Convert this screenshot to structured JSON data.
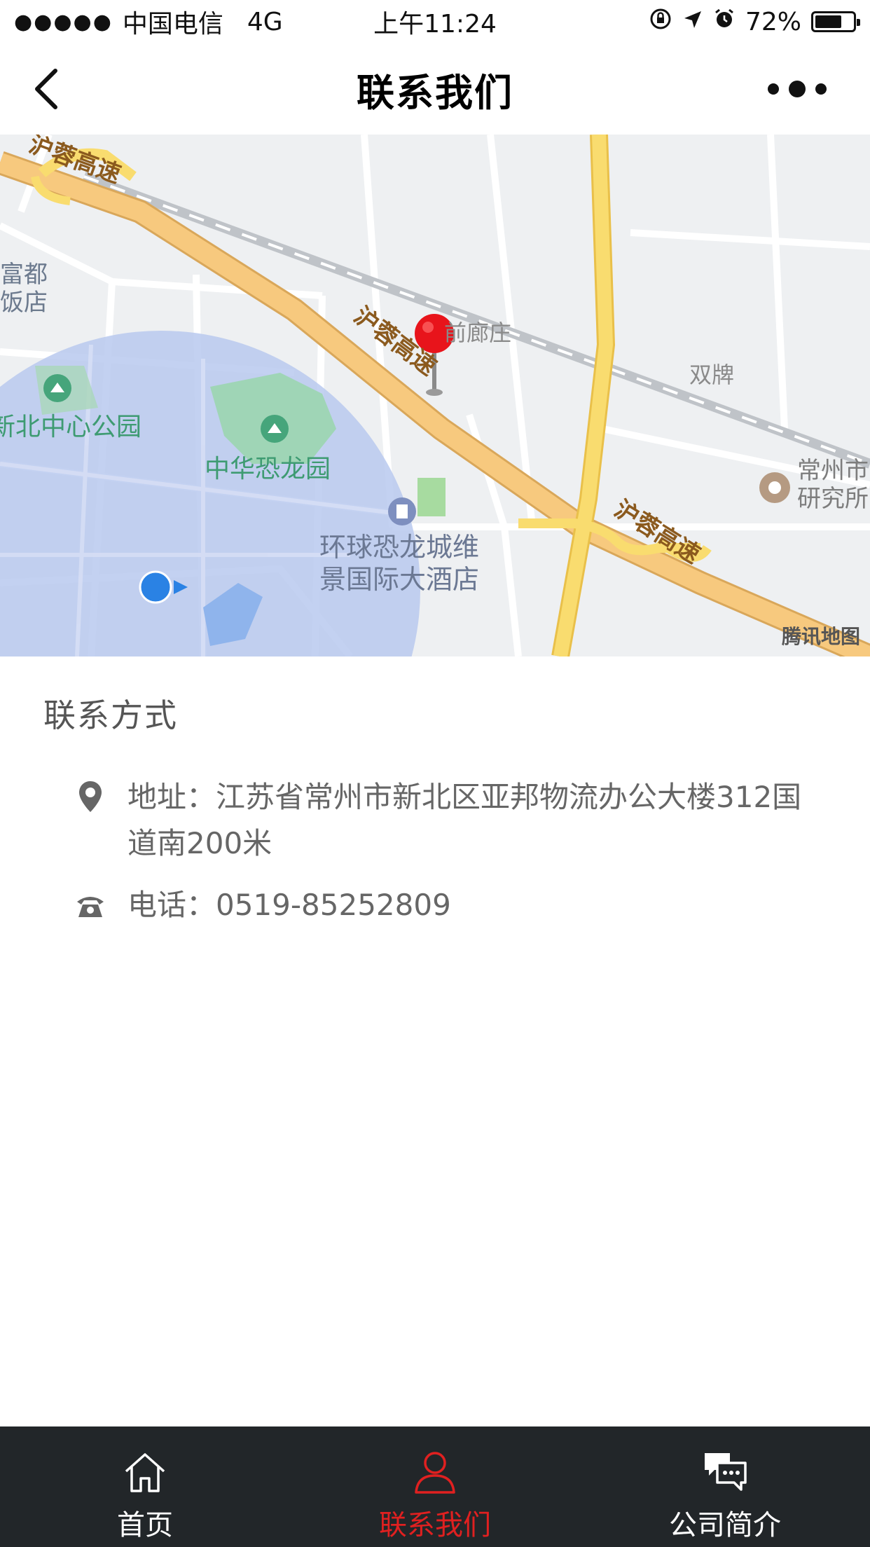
{
  "status_bar": {
    "signal": "●●●●●",
    "carrier": "中国电信",
    "network": "4G",
    "time": "上午11:24",
    "battery_percent": "72%",
    "battery_level": 0.72
  },
  "nav": {
    "title": "联系我们"
  },
  "map": {
    "labels": {
      "expressway_1": "沪蓉高速",
      "expressway_2": "沪蓉高速",
      "expressway_3": "沪蓉高速",
      "hotel_partial": "富都\n饭店",
      "park_left": "新北中心公园",
      "dino_park": "中华恐龙园",
      "village": "前廊庄",
      "shuangpai": "双牌",
      "institute": "常州市\n研究所",
      "hotel": "环球恐龙城维景国际大酒店"
    },
    "logo": "腾讯地图",
    "colors": {
      "background": "#eef0f2",
      "expressway": "#f7c97e",
      "major_road": "#f9dc6f",
      "radius_circle": "#b9c9ef",
      "park_green": "#9fd5b6",
      "water": "#8fb4ec",
      "pin": "#e8141b",
      "location_dot": "#2a82e4"
    }
  },
  "contact": {
    "section_title": "联系方式",
    "address": "地址：江苏省常州市新北区亚邦物流办公大楼312国道南200米",
    "phone": "电话：0519-85252809"
  },
  "tabbar": {
    "tabs": [
      {
        "label": "首页",
        "icon": "home-icon",
        "active": false
      },
      {
        "label": "联系我们",
        "icon": "person-icon",
        "active": true
      },
      {
        "label": "公司简介",
        "icon": "chat-icon",
        "active": false
      }
    ],
    "colors": {
      "background": "#222629",
      "active": "#e02020",
      "inactive": "#ffffff"
    }
  }
}
